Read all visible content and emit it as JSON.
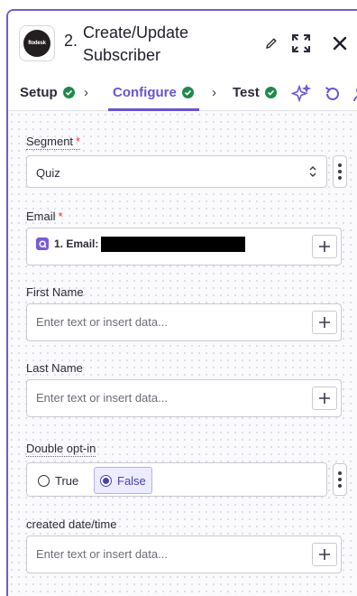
{
  "header": {
    "app_logo_text": "flodesk",
    "step_number": "2.",
    "title": "Create/Update Subscriber"
  },
  "tabs": [
    {
      "label": "Setup",
      "complete": true
    },
    {
      "label": "Configure",
      "complete": true,
      "active": true
    },
    {
      "label": "Test",
      "complete": true
    }
  ],
  "fields": {
    "segment": {
      "label": "Segment",
      "required": true,
      "value": "Quiz"
    },
    "email": {
      "label": "Email",
      "required": true,
      "value_label": "1. Email:"
    },
    "first_name": {
      "label": "First Name",
      "placeholder": "Enter text or insert data..."
    },
    "last_name": {
      "label": "Last Name",
      "placeholder": "Enter text or insert data..."
    },
    "double_opt_in": {
      "label": "Double opt-in",
      "options": [
        "True",
        "False"
      ],
      "selected": "False"
    },
    "created_datetime": {
      "label": "created date/time",
      "placeholder": "Enter text or insert data..."
    }
  },
  "colors": {
    "accent": "#6a55cf",
    "success": "#1f8a4c",
    "required": "#d9372a"
  }
}
